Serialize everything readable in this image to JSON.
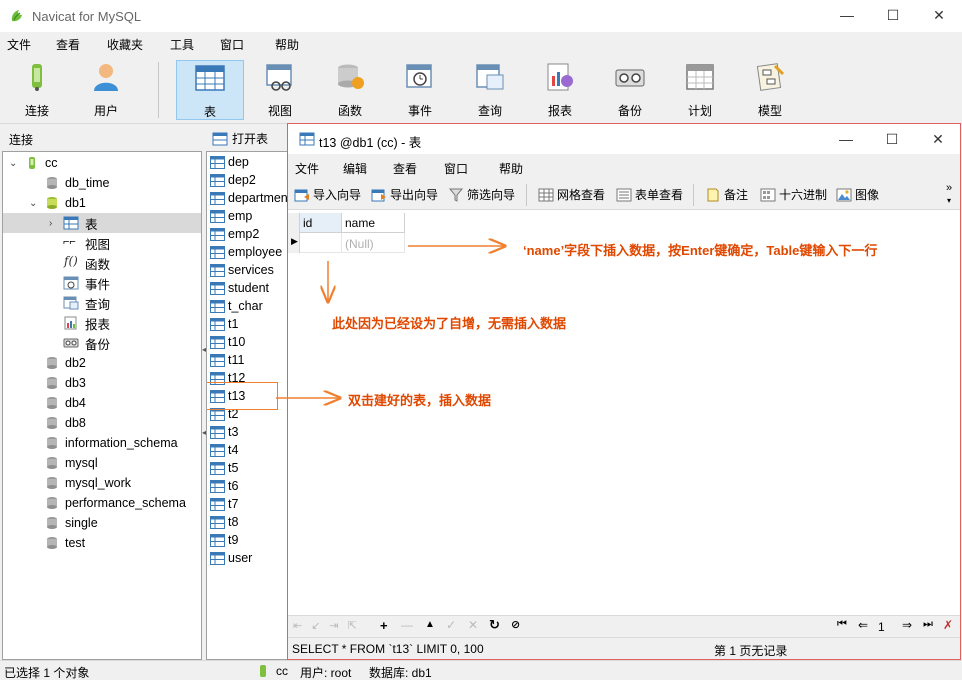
{
  "app": {
    "title": "Navicat for MySQL",
    "window_buttons": [
      "—",
      "☐",
      "✕"
    ]
  },
  "menu": [
    "文件",
    "查看",
    "收藏夹",
    "工具",
    "窗口",
    "帮助"
  ],
  "toolbar": [
    {
      "label": "连接",
      "icon": "connection-icon"
    },
    {
      "label": "用户",
      "icon": "user-icon"
    },
    {
      "label": "表",
      "icon": "table-icon",
      "active": true
    },
    {
      "label": "视图",
      "icon": "view-icon"
    },
    {
      "label": "函数",
      "icon": "function-icon"
    },
    {
      "label": "事件",
      "icon": "event-icon"
    },
    {
      "label": "查询",
      "icon": "query-icon"
    },
    {
      "label": "报表",
      "icon": "report-icon"
    },
    {
      "label": "备份",
      "icon": "backup-icon"
    },
    {
      "label": "计划",
      "icon": "schedule-icon"
    },
    {
      "label": "模型",
      "icon": "model-icon"
    }
  ],
  "left_panel": {
    "header": "连接",
    "tree": [
      {
        "label": "cc",
        "level": 0,
        "expanded": true,
        "icon": "connection-icon"
      },
      {
        "label": "db_time",
        "level": 1,
        "icon": "database-icon"
      },
      {
        "label": "db1",
        "level": 1,
        "expanded": true,
        "icon": "database-open-icon"
      },
      {
        "label": "表",
        "level": 2,
        "selected": true,
        "collapsed": true,
        "icon": "table-icon"
      },
      {
        "label": "视图",
        "level": 2,
        "icon": "view-icon"
      },
      {
        "label": "函数",
        "level": 2,
        "icon": "function-icon"
      },
      {
        "label": "事件",
        "level": 2,
        "icon": "event-icon"
      },
      {
        "label": "查询",
        "level": 2,
        "icon": "query-icon"
      },
      {
        "label": "报表",
        "level": 2,
        "icon": "report-icon"
      },
      {
        "label": "备份",
        "level": 2,
        "icon": "backup-icon"
      },
      {
        "label": "db2",
        "level": 1,
        "icon": "database-icon"
      },
      {
        "label": "db3",
        "level": 1,
        "icon": "database-icon"
      },
      {
        "label": "db4",
        "level": 1,
        "icon": "database-icon"
      },
      {
        "label": "db8",
        "level": 1,
        "icon": "database-icon"
      },
      {
        "label": "information_schema",
        "level": 1,
        "icon": "database-icon"
      },
      {
        "label": "mysql",
        "level": 1,
        "icon": "database-icon"
      },
      {
        "label": "mysql_work",
        "level": 1,
        "icon": "database-icon"
      },
      {
        "label": "performance_schema",
        "level": 1,
        "icon": "database-icon"
      },
      {
        "label": "single",
        "level": 1,
        "icon": "database-icon"
      },
      {
        "label": "test",
        "level": 1,
        "icon": "database-icon"
      }
    ]
  },
  "object_panel": {
    "open_table_label": "打开表",
    "tables": [
      "dep",
      "dep2",
      "department",
      "emp",
      "emp2",
      "employee",
      "services",
      "student",
      "t_char",
      "t1",
      "t10",
      "t11",
      "t12",
      "t13",
      "t2",
      "t3",
      "t4",
      "t5",
      "t6",
      "t7",
      "t8",
      "t9",
      "user"
    ],
    "highlighted": "t13"
  },
  "inner_window": {
    "title": "t13 @db1 (cc) - 表",
    "menu": [
      "文件",
      "编辑",
      "查看",
      "窗口",
      "帮助"
    ],
    "toolbar": [
      {
        "label": "导入向导",
        "icon": "import-icon"
      },
      {
        "label": "导出向导",
        "icon": "export-icon"
      },
      {
        "label": "筛选向导",
        "icon": "filter-icon"
      },
      {
        "label": "网格查看",
        "icon": "grid-view-icon"
      },
      {
        "label": "表单查看",
        "icon": "form-view-icon"
      },
      {
        "label": "备注",
        "icon": "memo-icon"
      },
      {
        "label": "十六进制",
        "icon": "hex-icon"
      },
      {
        "label": "图像",
        "icon": "image-icon"
      }
    ],
    "grid": {
      "columns": [
        "id",
        "name"
      ],
      "rows": [
        [
          "",
          "(Null)"
        ]
      ]
    },
    "page": "1",
    "sql": "SELECT * FROM `t13` LIMIT 0, 100",
    "page_status": "第 1 页无记录"
  },
  "statusbar": {
    "selection": "已选择 1 个对象",
    "connection": "cc",
    "user": "用户: root",
    "database": "数据库: db1"
  },
  "annotations": {
    "name_hint": "‘name’字段下插入数据，按Enter键确定，Table键输入下一行",
    "id_hint": "此处因为已经设为了自增，无需插入数据",
    "table_hint": "双击建好的表，插入数据"
  },
  "colors": {
    "annotation": "#e04800",
    "active_tool_bg": "#cde6f7",
    "window_border": "#e06060"
  }
}
